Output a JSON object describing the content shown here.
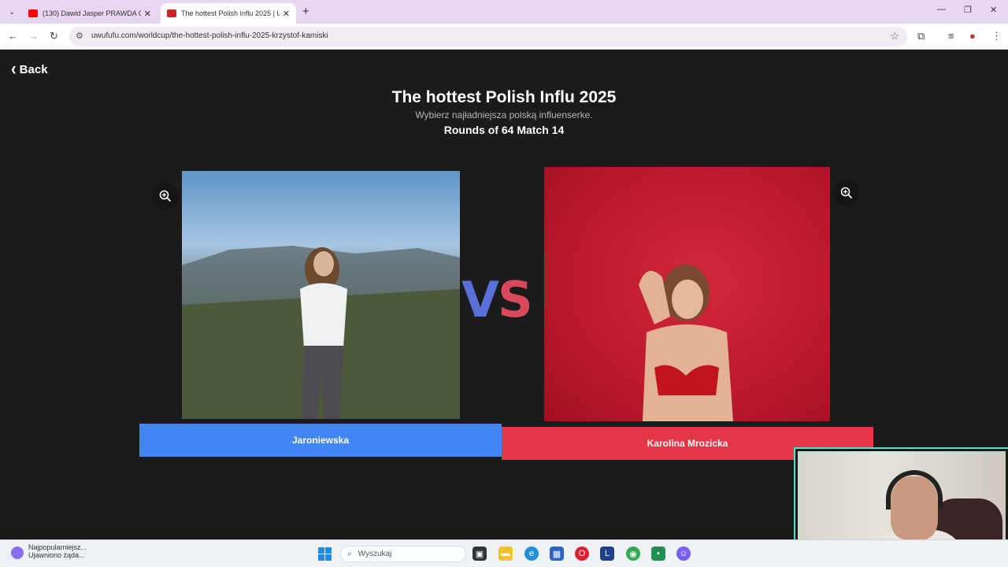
{
  "browser": {
    "tabs": [
      {
        "title": "(130) Dawid Jasper PRAWDA O",
        "favicon_color": "#ff0000",
        "active": false
      },
      {
        "title": "The hottest Polish Influ 2025 | U",
        "favicon_color": "#c62828",
        "active": true
      }
    ],
    "url": "uwufufu.com/worldcup/the-hottest-polish-influ-2025-krzystof-kamiski"
  },
  "page": {
    "back_label": "Back",
    "title": "The hottest Polish Influ 2025",
    "subtitle": "Wybierz najładniejsza polską influenserke.",
    "round_label": "Rounds of 64 Match 14",
    "vs_v": "V",
    "vs_s": "S",
    "left_choice": "Jaroniewska",
    "right_choice": "Karolina Mrozicka",
    "colors": {
      "left_button": "#4285f4",
      "right_button": "#e33647",
      "vs_v": "#5870d8",
      "vs_s": "#d8495c"
    }
  },
  "taskbar": {
    "notification_title": "Najpopularniejsz...",
    "notification_text": "Ujawniono żąda...",
    "search_placeholder": "Wyszukaj"
  }
}
